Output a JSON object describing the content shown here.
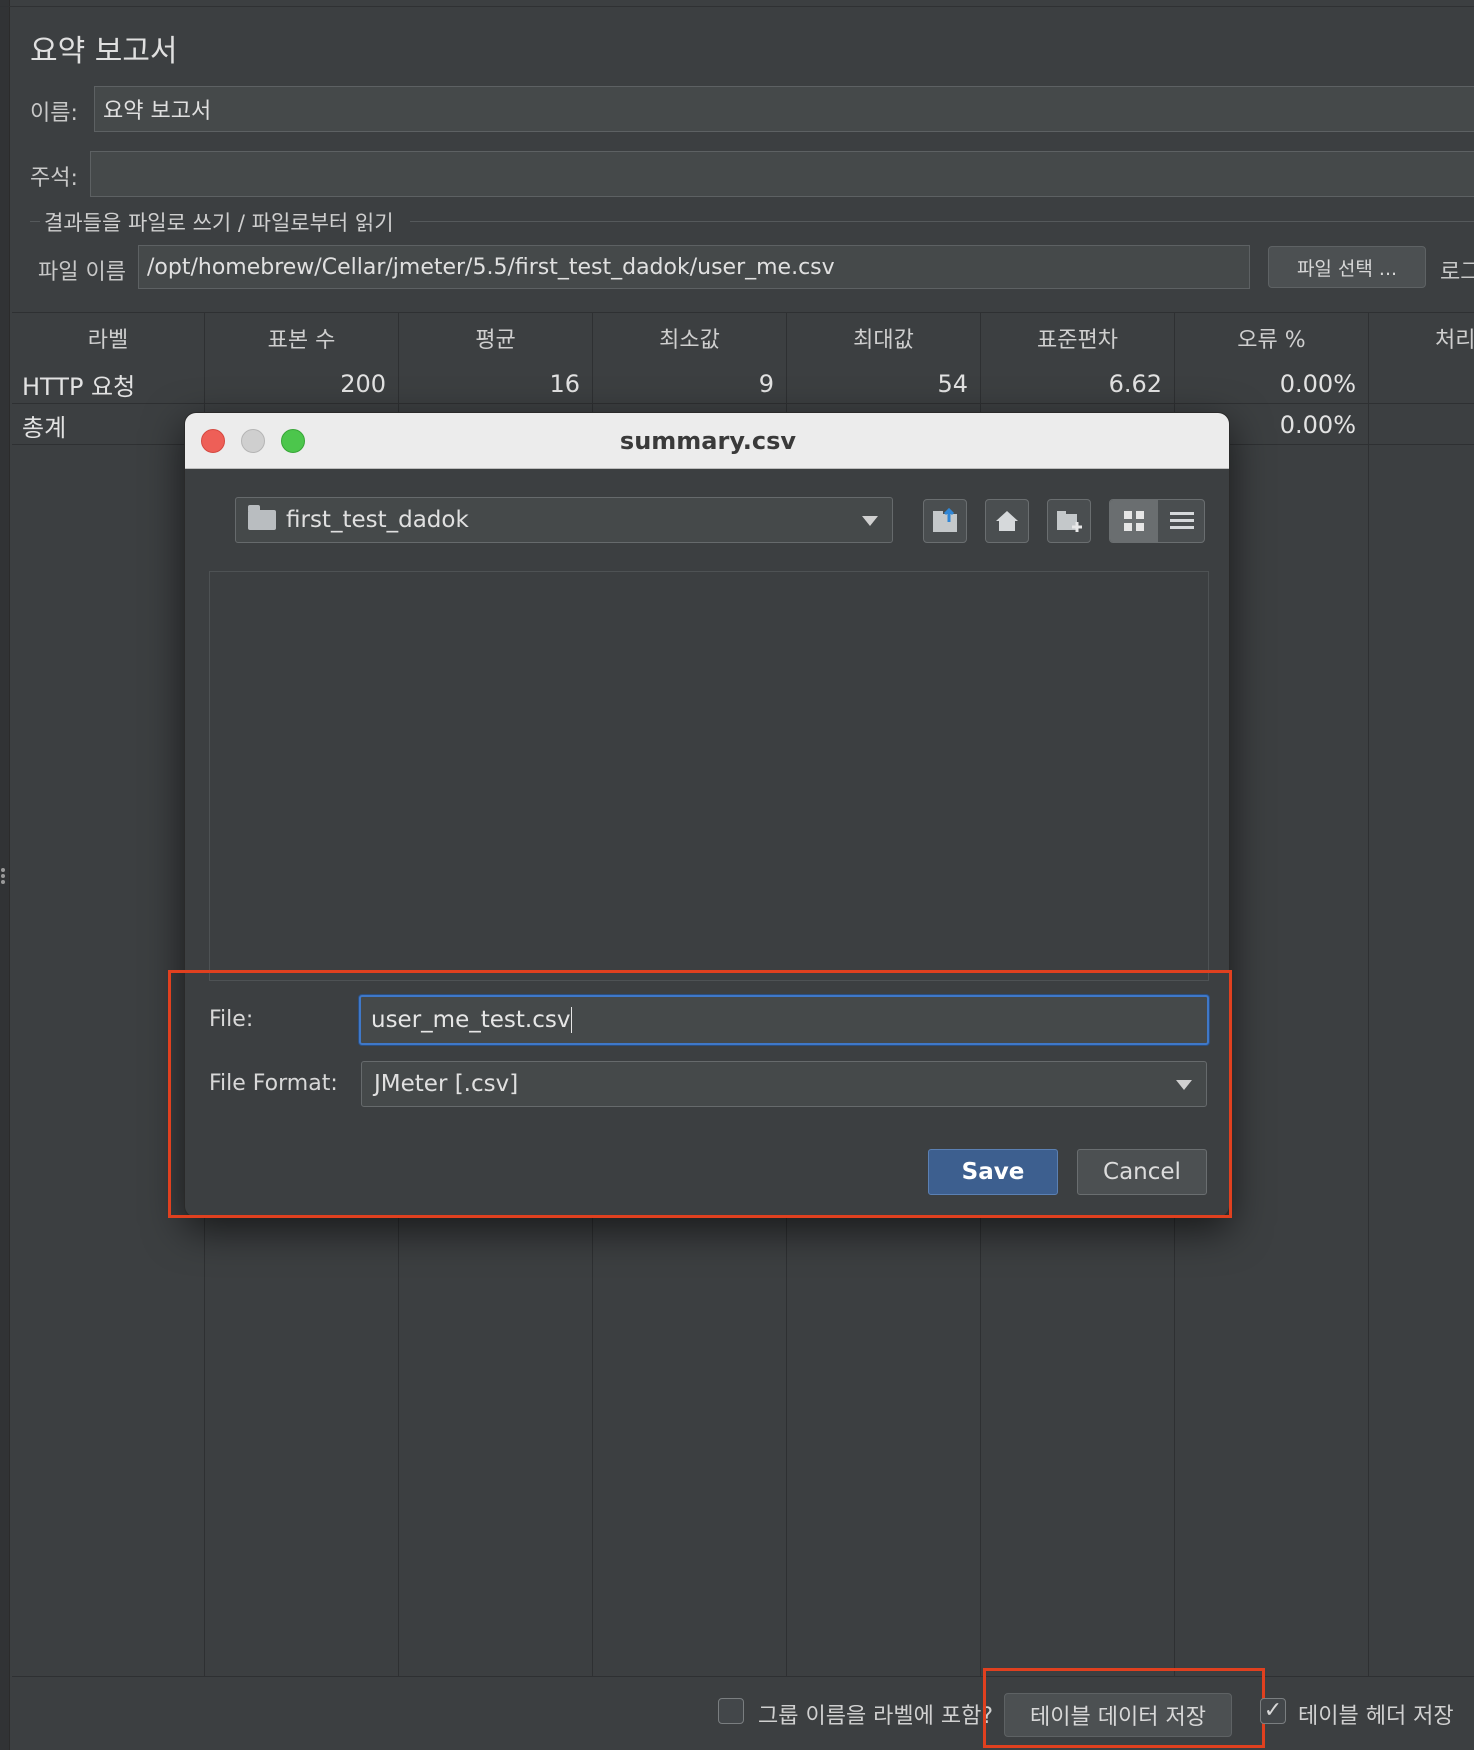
{
  "panel": {
    "title": "요약 보고서",
    "name_label": "이름:",
    "name_value": "요약 보고서",
    "comment_label": "주석:",
    "comment_value": "",
    "file_group_title": "결과들을 파일로 쓰기 / 파일로부터 읽기",
    "filename_label": "파일 이름",
    "filename_value": "/opt/homebrew/Cellar/jmeter/5.5/first_test_dadok/user_me.csv",
    "browse_button": "파일 선택 ...",
    "log_label_partial": "로그"
  },
  "table": {
    "headers": [
      "라벨",
      "표본 수",
      "평균",
      "최소값",
      "최대값",
      "표준편차",
      "오류 %",
      "처리"
    ],
    "rows": [
      [
        "HTTP 요청",
        "200",
        "16",
        "9",
        "54",
        "6.62",
        "0.00%"
      ],
      [
        "총계",
        "",
        "",
        "",
        "",
        "",
        "0.00%"
      ]
    ]
  },
  "dialog": {
    "title": "summary.csv",
    "folder": "first_test_dadok",
    "file_label": "File:",
    "file_value": "user_me_test.csv",
    "format_label": "File Format:",
    "format_value": "JMeter [.csv]",
    "save_button": "Save",
    "cancel_button": "Cancel"
  },
  "footer": {
    "group_name_checkbox": "그룹 이름을 라벨에 포함?",
    "group_name_checked": false,
    "save_table_button": "테이블 데이터 저장",
    "save_header_checkbox": "테이블 헤더 저장",
    "save_header_checked": true
  },
  "colors": {
    "background": "#3c3f41",
    "highlight": "#e0401f",
    "save_button": "#3d5f8f",
    "traffic_red": "#ee5f57",
    "traffic_gray": "#cfcfcf",
    "traffic_green": "#4cc64c"
  }
}
